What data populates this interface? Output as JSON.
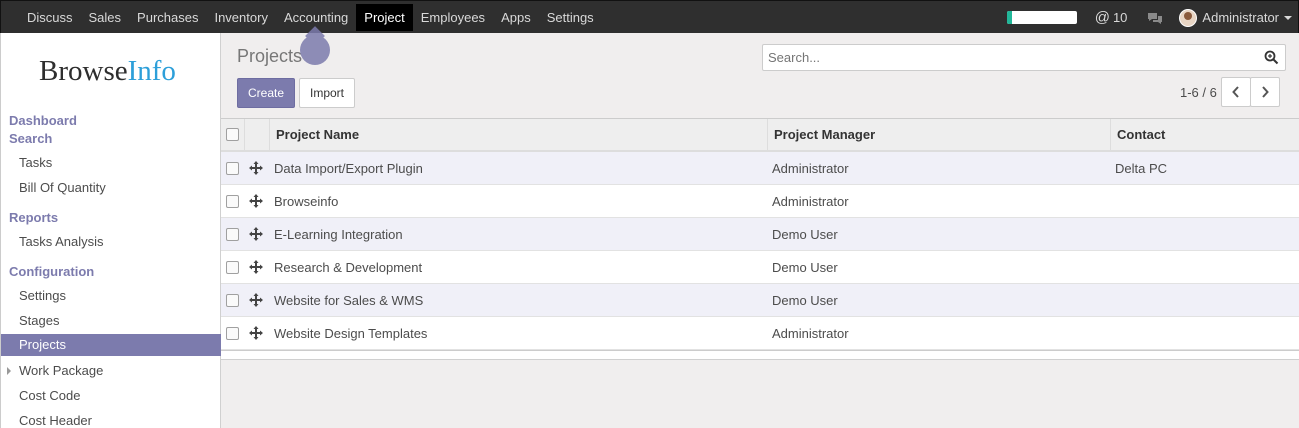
{
  "topbar": {
    "menu": [
      "Discuss",
      "Sales",
      "Purchases",
      "Inventory",
      "Accounting",
      "Project",
      "Employees",
      "Apps",
      "Settings"
    ],
    "active_menu": "Project",
    "progress": 0.08,
    "mentions": "10",
    "user": "Administrator"
  },
  "sidebar": {
    "logo_a": "Browse",
    "logo_b": "Info",
    "sections": {
      "dashboard": "Dashboard",
      "search": "Search",
      "tasks": "Tasks",
      "boq": "Bill Of Quantity",
      "reports": "Reports",
      "tasks_analysis": "Tasks Analysis",
      "configuration": "Configuration",
      "settings": "Settings",
      "stages": "Stages",
      "projects": "Projects",
      "work_package": "Work Package",
      "cost_code": "Cost Code",
      "cost_header": "Cost Header"
    }
  },
  "main": {
    "title": "Projects",
    "create_label": "Create",
    "import_label": "Import",
    "search_placeholder": "Search...",
    "pager": "1-6 / 6",
    "columns": [
      "Project Name",
      "Project Manager",
      "Contact"
    ],
    "rows": [
      {
        "name": "Data Import/Export Plugin",
        "manager": "Administrator",
        "contact": "Delta PC"
      },
      {
        "name": "Browseinfo",
        "manager": "Administrator",
        "contact": ""
      },
      {
        "name": "E-Learning Integration",
        "manager": "Demo User",
        "contact": ""
      },
      {
        "name": "Research & Development",
        "manager": "Demo User",
        "contact": ""
      },
      {
        "name": "Website for Sales & WMS",
        "manager": "Demo User",
        "contact": ""
      },
      {
        "name": "Website Design Templates",
        "manager": "Administrator",
        "contact": ""
      }
    ]
  },
  "colors": {
    "accent": "#7c7bad",
    "topbar": "#2f2f2f",
    "progress": "#21b799"
  }
}
